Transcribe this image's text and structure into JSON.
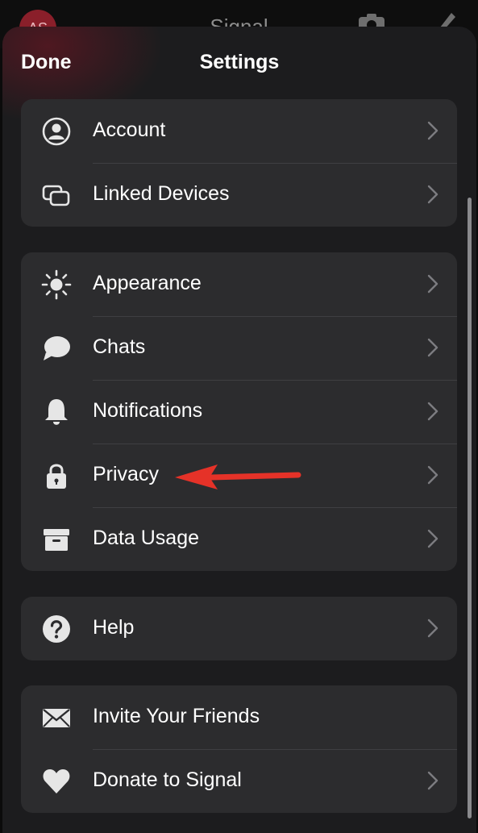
{
  "background_app": {
    "avatar_initials": "AS",
    "title": "Signal"
  },
  "header": {
    "done_label": "Done",
    "title": "Settings"
  },
  "groups": [
    {
      "items": [
        {
          "label": "Account",
          "icon": "person-circle-icon",
          "chevron": true
        },
        {
          "label": "Linked Devices",
          "icon": "linked-devices-icon",
          "chevron": true
        }
      ]
    },
    {
      "items": [
        {
          "label": "Appearance",
          "icon": "sun-icon",
          "chevron": true
        },
        {
          "label": "Chats",
          "icon": "chat-bubble-icon",
          "chevron": true
        },
        {
          "label": "Notifications",
          "icon": "bell-icon",
          "chevron": true
        },
        {
          "label": "Privacy",
          "icon": "lock-icon",
          "chevron": true
        },
        {
          "label": "Data Usage",
          "icon": "archive-box-icon",
          "chevron": true
        }
      ]
    },
    {
      "items": [
        {
          "label": "Help",
          "icon": "question-circle-icon",
          "chevron": true
        }
      ]
    },
    {
      "items": [
        {
          "label": "Invite Your Friends",
          "icon": "envelope-icon",
          "chevron": false
        },
        {
          "label": "Donate to Signal",
          "icon": "heart-icon",
          "chevron": true
        }
      ]
    }
  ],
  "colors": {
    "sheet_background": "#1c1c1e",
    "group_background": "#2c2c2e",
    "annotation_arrow": "#e53228"
  }
}
